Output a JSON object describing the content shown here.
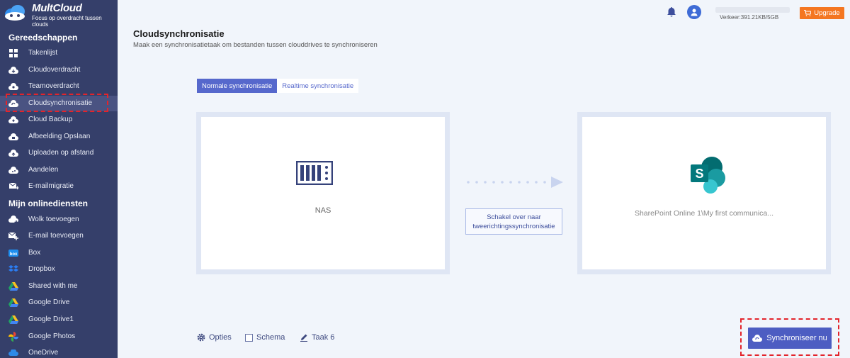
{
  "app": {
    "name": "MultCloud",
    "tagline": "Focus op overdracht tussen clouds"
  },
  "sidebar": {
    "tools_heading": "Gereedschappen",
    "tools": [
      {
        "label": "Takenlijst",
        "icon": "grid-icon"
      },
      {
        "label": "Cloudoverdracht",
        "icon": "cloud-transfer-icon"
      },
      {
        "label": "Teamoverdracht",
        "icon": "team-transfer-icon"
      },
      {
        "label": "Cloudsynchronisatie",
        "icon": "cloud-sync-icon",
        "active": true
      },
      {
        "label": "Cloud Backup",
        "icon": "cloud-backup-icon"
      },
      {
        "label": "Afbeelding Opslaan",
        "icon": "image-save-icon"
      },
      {
        "label": "Uploaden op afstand",
        "icon": "remote-upload-icon"
      },
      {
        "label": "Aandelen",
        "icon": "share-icon"
      },
      {
        "label": "E-mailmigratie",
        "icon": "email-migration-icon"
      }
    ],
    "services_heading": "Mijn onlinediensten",
    "services": [
      {
        "label": "Wolk toevoegen",
        "icon": "add-cloud-icon"
      },
      {
        "label": "E-mail toevoegen",
        "icon": "add-email-icon"
      },
      {
        "label": "Box",
        "icon": "box-icon"
      },
      {
        "label": "Dropbox",
        "icon": "dropbox-icon"
      },
      {
        "label": "Shared with me",
        "icon": "google-drive-shared-icon"
      },
      {
        "label": "Google Drive",
        "icon": "google-drive-icon"
      },
      {
        "label": "Google Drive1",
        "icon": "google-drive-icon"
      },
      {
        "label": "Google Photos",
        "icon": "google-photos-icon"
      },
      {
        "label": "OneDrive",
        "icon": "onedrive-icon"
      }
    ]
  },
  "topbar": {
    "traffic": "Verkeer:391.21KB/5GB",
    "upgrade_label": "Upgrade"
  },
  "page": {
    "title": "Cloudsynchronisatie",
    "subtitle": "Maak een synchronisatietaak om bestanden tussen clouddrives te synchroniseren"
  },
  "tabs": [
    {
      "label": "Normale synchronisatie",
      "active": true
    },
    {
      "label": "Realtime synchronisatie",
      "active": false
    }
  ],
  "source": {
    "label": "NAS",
    "icon": "nas-icon"
  },
  "target": {
    "label": "SharePoint Online 1\\My first communica...",
    "icon": "sharepoint-icon"
  },
  "switch_button": "Schakel over naar tweerichtingssynchronisatie",
  "options": {
    "options_label": "Opties",
    "schema_label": "Schema",
    "task_label": "Taak 6"
  },
  "sync_button": "Synchroniseer nu",
  "colors": {
    "sidebar_bg": "#353f6a",
    "accent": "#5668cc",
    "upgrade": "#f47621",
    "highlight": "#e3242b"
  }
}
